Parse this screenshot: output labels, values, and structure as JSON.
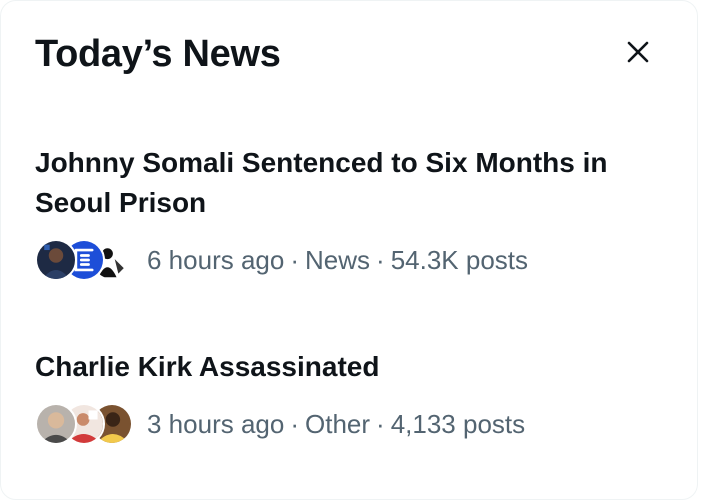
{
  "panel": {
    "title": "Today’s News",
    "close_icon": "close-icon"
  },
  "items": [
    {
      "headline_line1": "Johnny Somali Sentenced to Six Months in",
      "headline_line2": "Seoul Prison",
      "time": "6 hours ago",
      "category": "News",
      "posts": "54.3K posts",
      "separator": "·"
    },
    {
      "headline_line1": "Charlie Kirk Assassinated",
      "headline_line2": "",
      "time": "3 hours ago",
      "category": "Other",
      "posts": "4,133 posts",
      "separator": "·"
    }
  ],
  "colors": {
    "text_primary": "#0f1419",
    "text_secondary": "#536471",
    "accent_blue": "#1d4ed8"
  }
}
